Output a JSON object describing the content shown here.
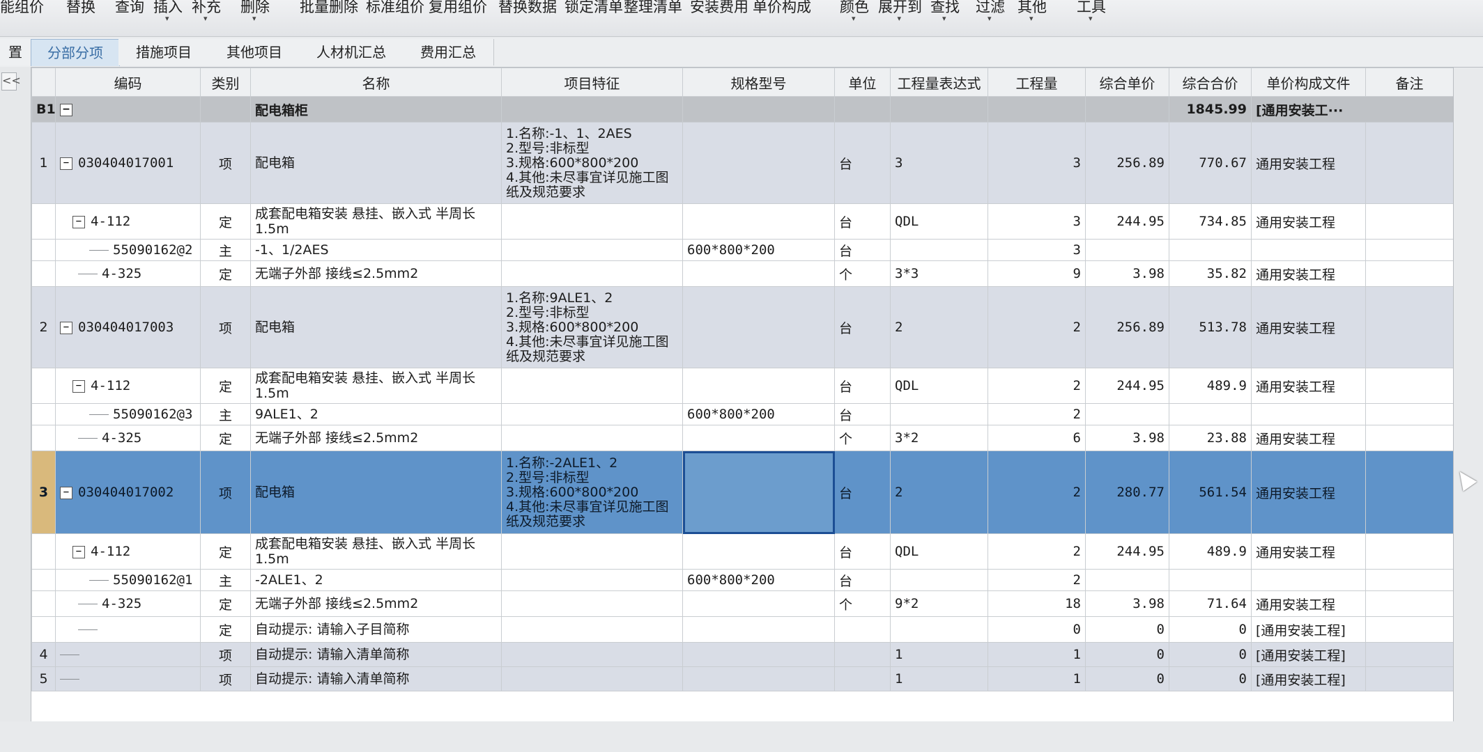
{
  "ribbon": [
    {
      "label": "能组价"
    },
    {
      "label": "替换"
    },
    {
      "label": "查询"
    },
    {
      "label": "插入"
    },
    {
      "label": "补充"
    },
    {
      "label": "删除"
    },
    {
      "label": "批量删除"
    },
    {
      "label": "标准组价"
    },
    {
      "label": "复用组价"
    },
    {
      "label": "替换数据"
    },
    {
      "label": "锁定清单"
    },
    {
      "label": "整理清单"
    },
    {
      "label": "安装费用"
    },
    {
      "label": "单价构成"
    },
    {
      "label": "颜色"
    },
    {
      "label": "展开到"
    },
    {
      "label": "查找"
    },
    {
      "label": "过滤"
    },
    {
      "label": "其他"
    },
    {
      "label": "工具"
    }
  ],
  "tabs": [
    {
      "label": "置"
    },
    {
      "label": "分部分项"
    },
    {
      "label": "措施项目"
    },
    {
      "label": "其他项目"
    },
    {
      "label": "人材机汇总"
    },
    {
      "label": "费用汇总"
    }
  ],
  "collapse_label": "<<",
  "headers": {
    "code": "编码",
    "type": "类别",
    "name": "名称",
    "feature": "项目特征",
    "spec": "规格型号",
    "unit": "单位",
    "expr": "工程量表达式",
    "qty": "工程量",
    "price": "综合单价",
    "total": "综合合价",
    "file": "单价构成文件",
    "note": "备注"
  },
  "group": {
    "rn": "B1",
    "toggle": "−",
    "name": "配电箱柜",
    "total": "1845.99",
    "file": "[通用安装工···"
  },
  "rows": [
    {
      "kind": "item",
      "rn": "1",
      "code": "030404017001",
      "type": "项",
      "name": "配电箱",
      "feature": "1.名称:-1、1、2AES\n2.型号:非标型\n3.规格:600*800*200\n4.其他:未尽事宜详见施工图纸及规范要求",
      "spec": "",
      "unit": "台",
      "expr": "3",
      "qty": "3",
      "price": "256.89",
      "total": "770.67",
      "file": "通用安装工程"
    },
    {
      "kind": "sub",
      "rn": "",
      "code": "4-112",
      "toggle": "−",
      "type": "定",
      "name": "成套配电箱安装 悬挂、嵌入式 半周长1.5m",
      "feature": "",
      "spec": "",
      "unit": "台",
      "expr": "QDL",
      "qty": "3",
      "price": "244.95",
      "total": "734.85",
      "file": "通用安装工程"
    },
    {
      "kind": "sub2",
      "rn": "",
      "code": "55090162@2",
      "type": "主",
      "name": "-1、1/2AES",
      "feature": "",
      "spec": "600*800*200",
      "unit": "台",
      "expr": "",
      "qty": "3",
      "price": "",
      "total": "",
      "file": ""
    },
    {
      "kind": "sub1",
      "rn": "",
      "code": "4-325",
      "type": "定",
      "name": "无端子外部 接线≤2.5mm2",
      "feature": "",
      "spec": "",
      "unit": "个",
      "expr": "3*3",
      "qty": "9",
      "price": "3.98",
      "total": "35.82",
      "file": "通用安装工程"
    },
    {
      "kind": "item",
      "rn": "2",
      "code": "030404017003",
      "type": "项",
      "name": "配电箱",
      "feature": "1.名称:9ALE1、2\n2.型号:非标型\n3.规格:600*800*200\n4.其他:未尽事宜详见施工图纸及规范要求",
      "spec": "",
      "unit": "台",
      "expr": "2",
      "qty": "2",
      "price": "256.89",
      "total": "513.78",
      "file": "通用安装工程"
    },
    {
      "kind": "sub",
      "rn": "",
      "code": "4-112",
      "toggle": "−",
      "type": "定",
      "name": "成套配电箱安装 悬挂、嵌入式 半周长1.5m",
      "feature": "",
      "spec": "",
      "unit": "台",
      "expr": "QDL",
      "qty": "2",
      "price": "244.95",
      "total": "489.9",
      "file": "通用安装工程"
    },
    {
      "kind": "sub2",
      "rn": "",
      "code": "55090162@3",
      "type": "主",
      "name": "9ALE1、2",
      "feature": "",
      "spec": "600*800*200",
      "unit": "台",
      "expr": "",
      "qty": "2",
      "price": "",
      "total": "",
      "file": ""
    },
    {
      "kind": "sub1",
      "rn": "",
      "code": "4-325",
      "type": "定",
      "name": "无端子外部 接线≤2.5mm2",
      "feature": "",
      "spec": "",
      "unit": "个",
      "expr": "3*2",
      "qty": "6",
      "price": "3.98",
      "total": "23.88",
      "file": "通用安装工程"
    },
    {
      "kind": "selected",
      "rn": "3",
      "code": "030404017002",
      "type": "项",
      "name": "配电箱",
      "feature": "1.名称:-2ALE1、2\n2.型号:非标型\n3.规格:600*800*200\n4.其他:未尽事宜详见施工图纸及规范要求",
      "spec": "",
      "unit": "台",
      "expr": "2",
      "qty": "2",
      "price": "280.77",
      "total": "561.54",
      "file": "通用安装工程"
    },
    {
      "kind": "sub",
      "rn": "",
      "code": "4-112",
      "toggle": "−",
      "type": "定",
      "name": "成套配电箱安装 悬挂、嵌入式 半周长1.5m",
      "feature": "",
      "spec": "",
      "unit": "台",
      "expr": "QDL",
      "qty": "2",
      "price": "244.95",
      "total": "489.9",
      "file": "通用安装工程"
    },
    {
      "kind": "sub2",
      "rn": "",
      "code": "55090162@1",
      "type": "主",
      "name": "-2ALE1、2",
      "feature": "",
      "spec": "600*800*200",
      "unit": "台",
      "expr": "",
      "qty": "2",
      "price": "",
      "total": "",
      "file": ""
    },
    {
      "kind": "sub1",
      "rn": "",
      "code": "4-325",
      "type": "定",
      "name": "无端子外部 接线≤2.5mm2",
      "feature": "",
      "spec": "",
      "unit": "个",
      "expr": "9*2",
      "qty": "18",
      "price": "3.98",
      "total": "71.64",
      "file": "通用安装工程"
    },
    {
      "kind": "sub1",
      "rn": "",
      "code": "",
      "type": "定",
      "name": "自动提示: 请输入子目简称",
      "feature": "",
      "spec": "",
      "unit": "",
      "expr": "",
      "qty": "0",
      "price": "0",
      "total": "0",
      "file": "[通用安装工程]"
    },
    {
      "kind": "item",
      "rn": "4",
      "code": "",
      "type": "项",
      "name": "自动提示: 请输入清单简称",
      "feature": "",
      "spec": "",
      "unit": "",
      "expr": "1",
      "qty": "1",
      "price": "0",
      "total": "0",
      "file": "[通用安装工程]"
    },
    {
      "kind": "item",
      "rn": "5",
      "code": "",
      "type": "项",
      "name": "自动提示: 请输入清单简称",
      "feature": "",
      "spec": "",
      "unit": "",
      "expr": "1",
      "qty": "1",
      "price": "0",
      "total": "0",
      "file": "[通用安装工程]"
    }
  ]
}
